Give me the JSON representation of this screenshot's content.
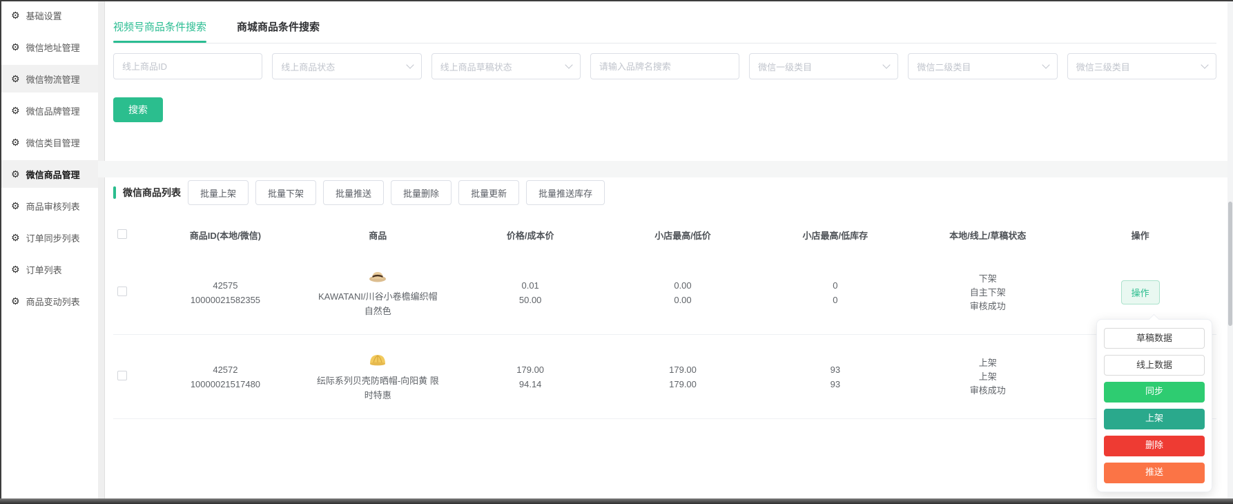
{
  "sidebar": {
    "items": [
      {
        "label": "基础设置",
        "highlighted": false,
        "active": false
      },
      {
        "label": "微信地址管理",
        "highlighted": false,
        "active": false
      },
      {
        "label": "微信物流管理",
        "highlighted": true,
        "active": false
      },
      {
        "label": "微信品牌管理",
        "highlighted": false,
        "active": false
      },
      {
        "label": "微信类目管理",
        "highlighted": false,
        "active": false
      },
      {
        "label": "微信商品管理",
        "highlighted": true,
        "active": true
      },
      {
        "label": "商品审核列表",
        "highlighted": false,
        "active": false
      },
      {
        "label": "订单同步列表",
        "highlighted": false,
        "active": false
      },
      {
        "label": "订单列表",
        "highlighted": false,
        "active": false
      },
      {
        "label": "商品变动列表",
        "highlighted": false,
        "active": false
      }
    ]
  },
  "tabs": [
    {
      "label": "视频号商品条件搜索",
      "active": true
    },
    {
      "label": "商城商品条件搜索",
      "active": false
    }
  ],
  "filters": {
    "online_product_id_placeholder": "线上商品ID",
    "online_product_status_placeholder": "线上商品状态",
    "online_draft_status_placeholder": "线上商品草稿状态",
    "brand_search_placeholder": "请输入品牌名搜索",
    "wechat_category1_placeholder": "微信一级类目",
    "wechat_category2_placeholder": "微信二级类目",
    "wechat_category3_placeholder": "微信三级类目",
    "search_button": "搜索"
  },
  "list": {
    "title": "微信商品列表",
    "batch_buttons": [
      "批量上架",
      "批量下架",
      "批量推送",
      "批量删除",
      "批量更新",
      "批量推送库存"
    ],
    "columns": [
      "商品ID(本地/微信)",
      "商品",
      "价格/成本价",
      "小店最高/低价",
      "小店最高/低库存",
      "本地/线上/草稿状态",
      "操作"
    ],
    "rows": [
      {
        "local_id": "42575",
        "wechat_id": "10000021582355",
        "name_line1": "KAWATANI/川谷小卷檐编织帽",
        "name_line2": "自然色",
        "price": "0.01",
        "cost": "50.00",
        "shop_high": "0.00",
        "shop_low": "0.00",
        "stock_high": "0",
        "stock_low": "0",
        "status_local": "下架",
        "status_online": "自主下架",
        "status_draft": "审核成功",
        "action_label": "操作"
      },
      {
        "local_id": "42572",
        "wechat_id": "10000021517480",
        "name_line1": "纭际系列贝壳防晒帽-向阳黄 限",
        "name_line2": "时特惠",
        "price": "179.00",
        "cost": "94.14",
        "shop_high": "179.00",
        "shop_low": "179.00",
        "stock_high": "93",
        "stock_low": "93",
        "status_local": "上架",
        "status_online": "上架",
        "status_draft": "审核成功"
      }
    ]
  },
  "action_menu": {
    "items": [
      {
        "label": "草稿数据",
        "style": "plain"
      },
      {
        "label": "线上数据",
        "style": "plain"
      },
      {
        "label": "同步",
        "style": "green"
      },
      {
        "label": "上架",
        "style": "teal"
      },
      {
        "label": "删除",
        "style": "red"
      },
      {
        "label": "推送",
        "style": "orange"
      }
    ]
  },
  "colors": {
    "accent_teal": "#2bbd8e",
    "sync_green": "#2ecc71",
    "onshelf_teal": "#2aa98c",
    "delete_red": "#ee3b33",
    "push_orange": "#fb7446",
    "action_button_bg": "#e9f8f1"
  }
}
